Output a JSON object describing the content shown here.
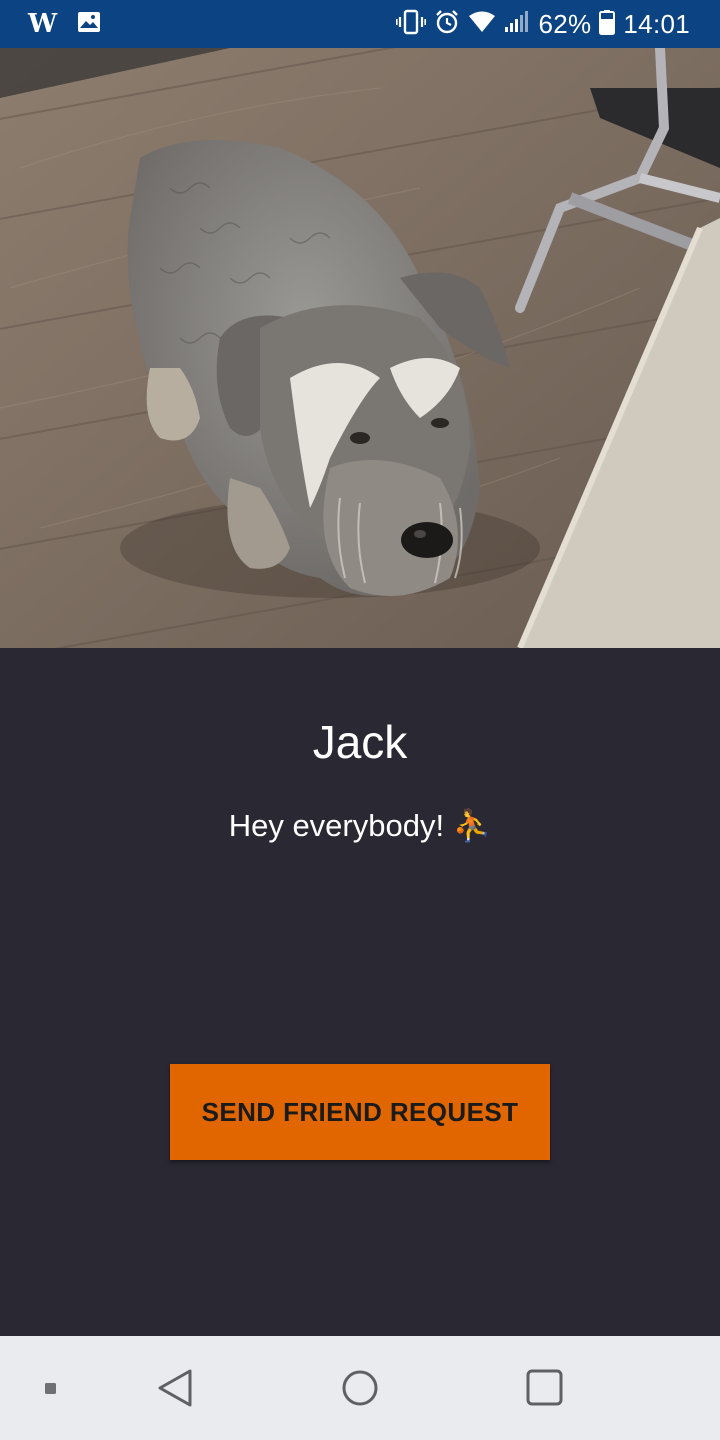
{
  "status_bar": {
    "left_icons": [
      "w-app-icon",
      "gallery-icon"
    ],
    "right_icons": [
      "vibrate-icon",
      "alarm-icon",
      "wifi-icon",
      "signal-icon",
      "battery-icon"
    ],
    "battery_percent": "62%",
    "time": "14:01",
    "background": "#0b4383"
  },
  "photo": {
    "subject_icon": "dog-photo"
  },
  "profile": {
    "name": "Jack",
    "status_text": "Hey everybody! ⛹️"
  },
  "actions": {
    "send_friend_request_label": "SEND FRIEND REQUEST",
    "accent_color": "#e26600"
  },
  "nav_bar": {
    "icons": [
      "menu-dot-icon",
      "back-icon",
      "home-icon",
      "recents-icon"
    ]
  }
}
